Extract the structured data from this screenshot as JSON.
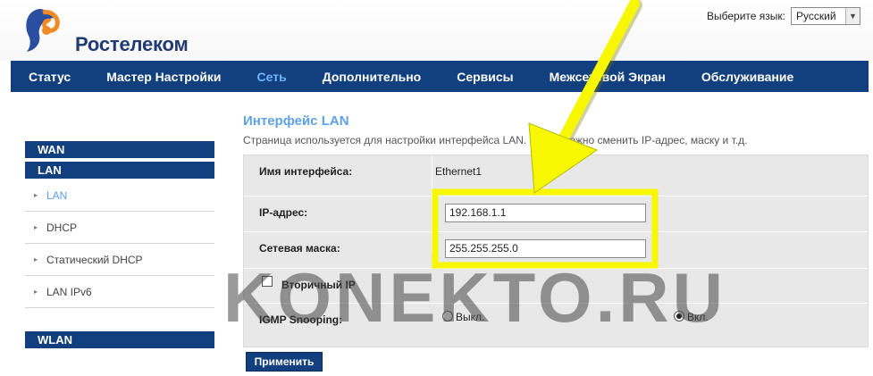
{
  "header": {
    "brand": "Ростелеком",
    "language_label": "Выберите язык:",
    "language_value": "Русский"
  },
  "nav": {
    "items": [
      "Статус",
      "Мастер Настройки",
      "Сеть",
      "Дополнительно",
      "Сервисы",
      "Межсетевой Экран",
      "Обслуживание"
    ],
    "active_index": 2
  },
  "sidebar": {
    "wan_label": "WAN",
    "lan_label": "LAN",
    "items": [
      "LAN",
      "DHCP",
      "Статический DHCP",
      "LAN IPv6"
    ],
    "active_index": 0,
    "wlan_label": "WLAN"
  },
  "main": {
    "title": "Интерфейс LAN",
    "description": "Страница используется для настройки интерфейса LAN. Здесь можно сменить IP-адрес, маску и т.д.",
    "interface_name_label": "Имя интерфейса:",
    "interface_name_value": "Ethernet1",
    "ip_label": "IP-адрес:",
    "ip_value": "192.168.1.1",
    "mask_label": "Сетевая маска:",
    "mask_value": "255.255.255.0",
    "secondary_ip_label": "Вторичный IP",
    "secondary_ip_checked": false,
    "igmp_label": "IGMP Snooping:",
    "igmp_off_label": "Выкл.",
    "igmp_on_label": "Вкл.",
    "igmp_value": "on",
    "apply_label": "Применить"
  },
  "watermark": "KONEKTO.RU",
  "colors": {
    "nav_bg": "#123f7e",
    "active_link": "#6fb3ff",
    "highlight": "#f7f700"
  }
}
